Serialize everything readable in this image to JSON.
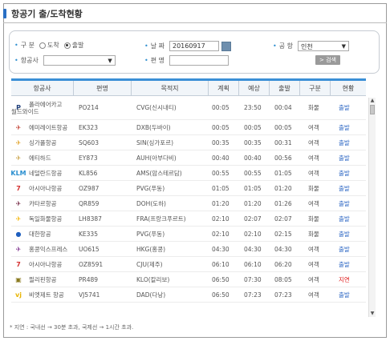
{
  "page_title": "항공기 출/도착현황",
  "search": {
    "type_label": "구  분",
    "opt_arrive": "도착",
    "opt_depart": "출발",
    "selected": "출발",
    "date_label": "날    짜",
    "date_value": "20160917",
    "airport_label": "공  항",
    "airport_value": "인천",
    "airline_label": "항공사",
    "airline_value": "",
    "flight_label": "편  명",
    "flight_value": "",
    "search_btn": "> 검색"
  },
  "table": {
    "headers": [
      "항공사",
      "편명",
      "목적지",
      "계획",
      "예상",
      "출발",
      "구분",
      "현황"
    ],
    "rows": [
      {
        "airline1": "폴라에어카고",
        "airline2": "월드와이드",
        "flight": "PO214",
        "dest": "CVG(신시내티)",
        "plan": "00:05",
        "est": "23:50",
        "dep": "00:04",
        "kind": "화물",
        "status": "출발",
        "logo_color": "#1f3f7a",
        "logo_glyph": "P"
      },
      {
        "airline1": "에미레이트항공",
        "flight": "EK323",
        "dest": "DXB(두바이)",
        "plan": "00:05",
        "est": "00:05",
        "dep": "00:05",
        "kind": "여객",
        "status": "출발",
        "logo_color": "#c0392b",
        "logo_glyph": "✈"
      },
      {
        "airline1": "싱가폴항공",
        "flight": "SQ603",
        "dest": "SIN(싱가포르)",
        "plan": "00:35",
        "est": "00:35",
        "dep": "00:31",
        "kind": "여객",
        "status": "출발",
        "logo_color": "#e0a020",
        "logo_glyph": "✈"
      },
      {
        "airline1": "에티하드",
        "flight": "EY873",
        "dest": "AUH(아부다비)",
        "plan": "00:40",
        "est": "00:40",
        "dep": "00:56",
        "kind": "여객",
        "status": "출발",
        "logo_color": "#c8a040",
        "logo_glyph": "✈"
      },
      {
        "airline1": "네덜란드항공",
        "flight": "KL856",
        "dest": "AMS(암스테르담)",
        "plan": "00:55",
        "est": "00:55",
        "dep": "01:05",
        "kind": "여객",
        "status": "출발",
        "logo_color": "#2a8fd0",
        "logo_glyph": "KLM"
      },
      {
        "airline1": "아시아나항공",
        "flight": "OZ987",
        "dest": "PVG(푸동)",
        "plan": "01:05",
        "est": "01:05",
        "dep": "01:20",
        "kind": "화물",
        "status": "출발",
        "logo_color": "#d32f2f",
        "logo_glyph": "7"
      },
      {
        "airline1": "카타르항공",
        "flight": "QR859",
        "dest": "DOH(도하)",
        "plan": "01:20",
        "est": "01:20",
        "dep": "01:26",
        "kind": "여객",
        "status": "출발",
        "logo_color": "#6d1f3b",
        "logo_glyph": "✈"
      },
      {
        "airline1": "독일화물항공",
        "flight": "LH8387",
        "dest": "FRA(프랑크푸르트)",
        "plan": "02:10",
        "est": "02:07",
        "dep": "02:07",
        "kind": "화물",
        "status": "출발",
        "logo_color": "#f5b400",
        "logo_glyph": "✈"
      },
      {
        "airline1": "대한항공",
        "flight": "KE335",
        "dest": "PVG(푸동)",
        "plan": "02:10",
        "est": "02:10",
        "dep": "02:15",
        "kind": "화물",
        "status": "출발",
        "logo_color": "#1f5fbf",
        "logo_glyph": "●"
      },
      {
        "airline1": "홍콩익스프레스",
        "flight": "UO615",
        "dest": "HKG(홍콩)",
        "plan": "04:30",
        "est": "04:30",
        "dep": "04:30",
        "kind": "여객",
        "status": "출발",
        "logo_color": "#7a2a8a",
        "logo_glyph": "✈"
      },
      {
        "airline1": "아시아나항공",
        "flight": "OZ8591",
        "dest": "CJU(제주)",
        "plan": "06:10",
        "est": "06:10",
        "dep": "06:20",
        "kind": "여객",
        "status": "출발",
        "logo_color": "#d32f2f",
        "logo_glyph": "7"
      },
      {
        "airline1": "필리핀항공",
        "flight": "PR489",
        "dest": "KLO(칼리보)",
        "plan": "06:50",
        "est": "07:30",
        "dep": "08:05",
        "kind": "여객",
        "status": "지연",
        "logo_color": "#8a7a20",
        "logo_glyph": "▣"
      },
      {
        "airline1": "비엣제트 항공",
        "flight": "VJ5741",
        "dest": "DAD(다낭)",
        "plan": "06:50",
        "est": "07:23",
        "dep": "07:23",
        "kind": "여객",
        "status": "출발",
        "logo_color": "#e8b400",
        "logo_glyph": "vj"
      }
    ]
  },
  "note": "* 지연 : 국내선 → 30분 초과, 국제선 → 1시간 초과."
}
